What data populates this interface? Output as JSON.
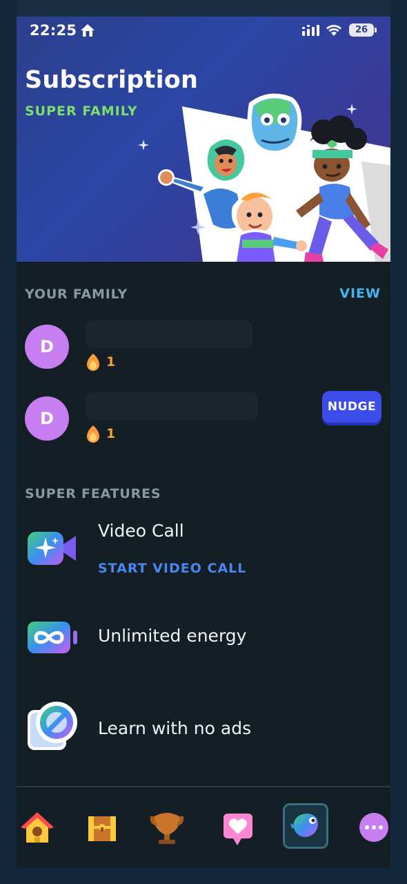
{
  "status_bar": {
    "time": "22:25",
    "battery": "26"
  },
  "header": {
    "title": "Subscription",
    "subtitle": "SUPER FAMILY"
  },
  "family": {
    "label": "YOUR FAMILY",
    "view_link": "VIEW",
    "members": [
      {
        "initial": "D",
        "streak": "1"
      },
      {
        "initial": "D",
        "streak": "1",
        "nudge_label": "NUDGE"
      }
    ]
  },
  "features": {
    "label": "SUPER FEATURES",
    "items": [
      {
        "title": "Video Call",
        "link": "START VIDEO CALL",
        "icon": "video-camera-sparkle-icon"
      },
      {
        "title": "Unlimited energy",
        "icon": "infinity-battery-icon"
      },
      {
        "title": "Learn with no ads",
        "icon": "no-ads-icon"
      }
    ]
  },
  "tab_bar": {
    "tabs": [
      "home-tab-icon",
      "treasure-chest-tab-icon",
      "leaderboard-tab-icon",
      "friends-tab-icon",
      "super-tab-icon",
      "more-tab-icon"
    ],
    "active": "super-tab-icon"
  },
  "colors": {
    "accent_green": "#7ee06a",
    "link_blue": "#46b4ef",
    "nudge_blue": "#3b4ce8",
    "avatar_purple": "#c77ef0",
    "streak_orange": "#f3a33a",
    "background": "#131f24"
  }
}
